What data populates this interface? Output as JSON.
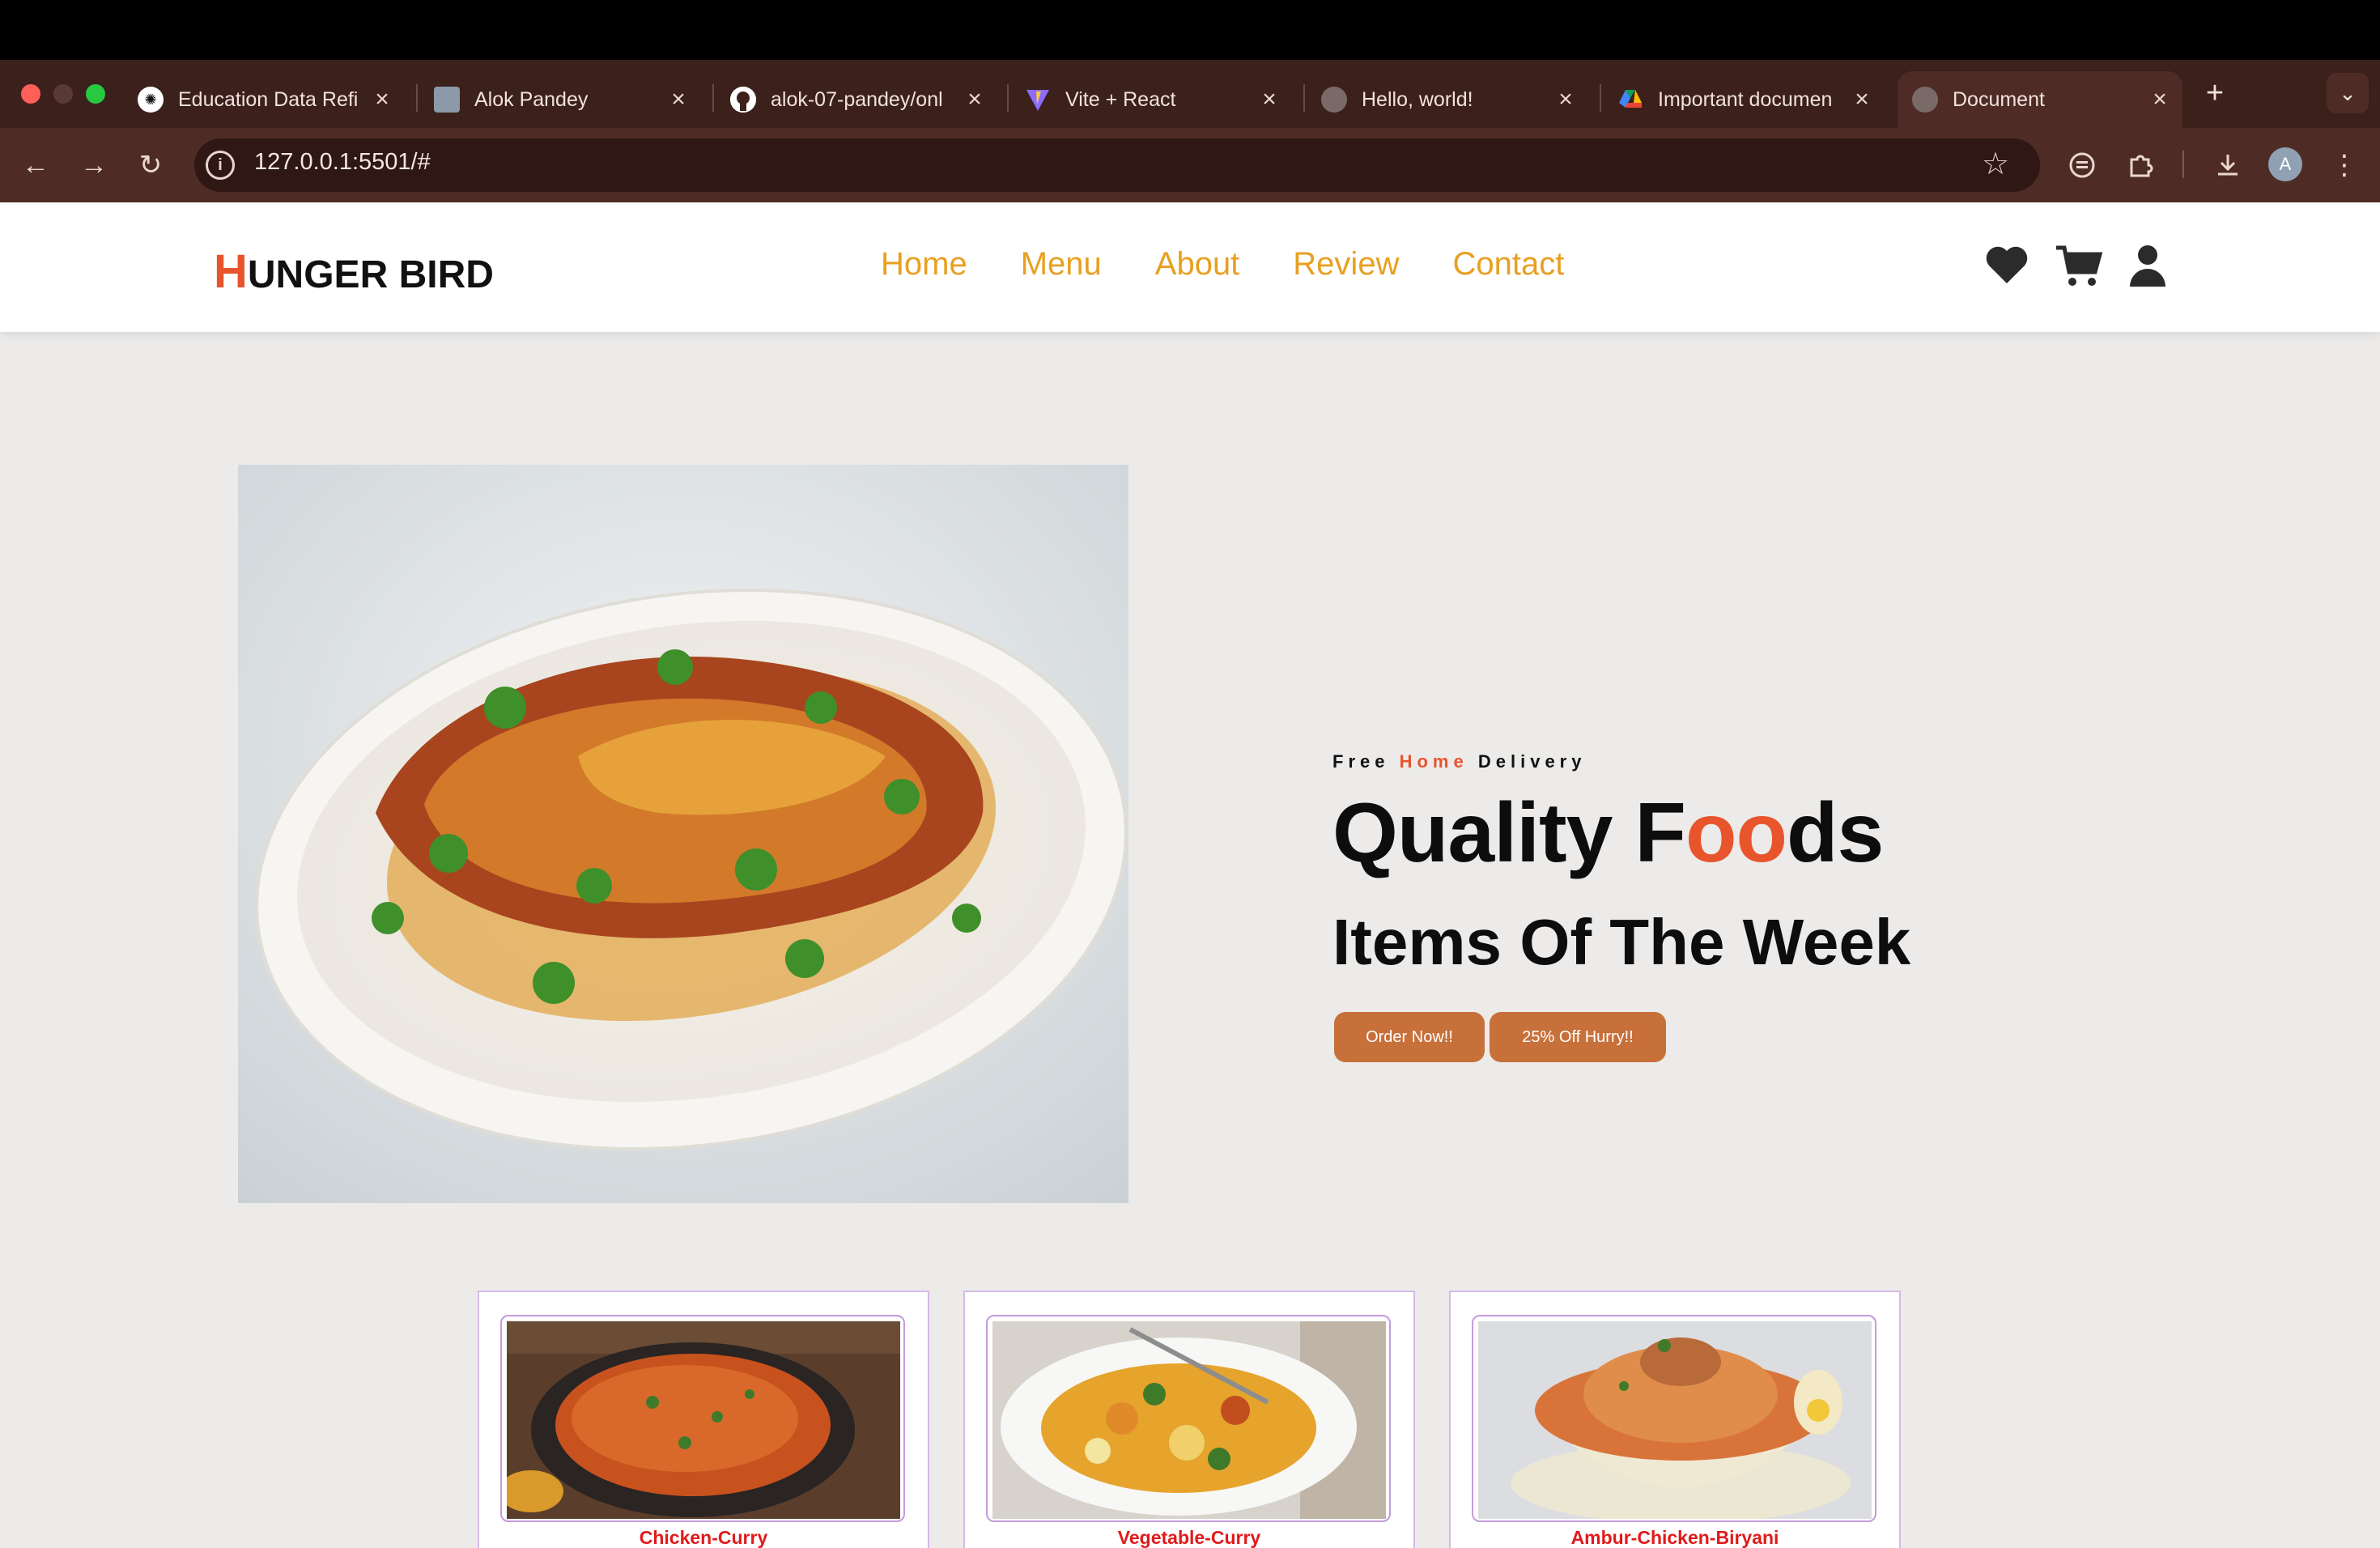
{
  "browser": {
    "tabs": [
      {
        "title": "Education Data Refi",
        "icon": "openai-icon"
      },
      {
        "title": "Alok Pandey",
        "icon": "profile-photo-icon"
      },
      {
        "title": "alok-07-pandey/onl",
        "icon": "github-icon"
      },
      {
        "title": "Vite + React",
        "icon": "vite-icon"
      },
      {
        "title": "Hello, world!",
        "icon": "globe-icon"
      },
      {
        "title": "Important documen",
        "icon": "google-drive-icon"
      },
      {
        "title": "Document",
        "icon": "globe-icon",
        "active": true
      }
    ],
    "url": "127.0.0.1:5501/#"
  },
  "site": {
    "logo_first": "H",
    "logo_rest": "UNGER BIRD",
    "nav": [
      "Home",
      "Menu",
      "About",
      "Review",
      "Contact"
    ],
    "header_icons": [
      "heart-icon",
      "cart-icon",
      "user-icon"
    ],
    "accent_color": "#e8542c",
    "nav_color": "#e8a021"
  },
  "hero": {
    "tagline_pre": "Free",
    "tagline_highlight": "Home",
    "tagline_post": "Delivery",
    "headline_part1": "Quality F",
    "headline_highlight": "oo",
    "headline_part2": "ds",
    "subheadline": "Items Of The Week",
    "order_button": "Order Now!!",
    "offer_button": "25% Off Hurry!!",
    "button_color": "#c8703a"
  },
  "cards": [
    {
      "name": "Chicken-Curry"
    },
    {
      "name": "Vegetable-Curry"
    },
    {
      "name": "Ambur-Chicken-Biryani"
    }
  ]
}
